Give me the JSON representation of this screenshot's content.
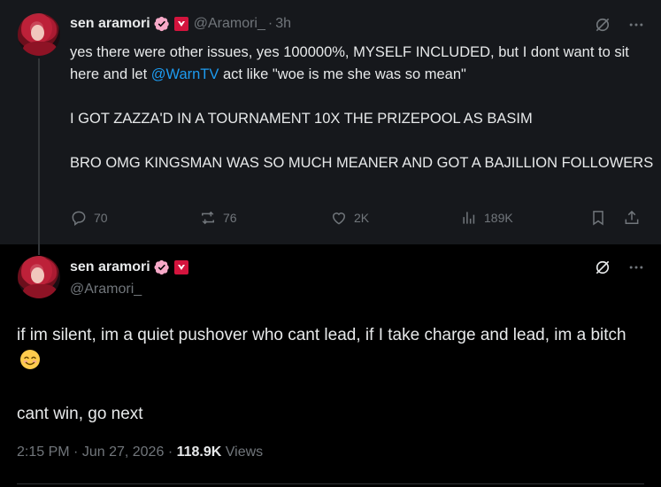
{
  "parent_tweet": {
    "display_name": "sen aramori",
    "handle": "@Aramori_",
    "separator": "·",
    "time": "3h",
    "text_line1_before": "yes there were other issues, yes 100000%, MYSELF INCLUDED, but I dont want to sit here and let ",
    "mention": "@WarnTV",
    "text_line1_after": " act like \"woe is me she was so mean\"",
    "text_para2": "I GOT ZAZZA'D IN A TOURNAMENT 10X THE PRIZEPOOL AS BASIM",
    "text_para3": "BRO OMG KINGSMAN WAS SO MUCH MEANER AND GOT A BAJILLION FOLLOWERS",
    "replies": "70",
    "reposts": "76",
    "likes": "2K",
    "views": "189K"
  },
  "current_tweet": {
    "display_name": "sen aramori",
    "handle": "@Aramori_",
    "text_para1": "if im silent, im a quiet pushover who cant lead, if I take charge and lead, im a bitch",
    "text_para2": "cant win, go next",
    "time": "2:15 PM",
    "date": "Jun 27, 2026",
    "separator": "·",
    "views_count": "118.9K",
    "views_label": "Views"
  },
  "colors": {
    "background": "#000000",
    "parent_background": "#16181c",
    "text": "#e7e9ea",
    "muted": "#71767b",
    "link": "#1d9bf0",
    "verified_badge": "#f7a9c8",
    "affiliate_badge": "#d3143d"
  },
  "icons": [
    "verified-icon",
    "affiliate-badge-icon",
    "grok-icon",
    "more-icon",
    "reply-icon",
    "repost-icon",
    "like-icon",
    "views-icon",
    "bookmark-icon",
    "share-icon",
    "smiling-face-emoji"
  ]
}
